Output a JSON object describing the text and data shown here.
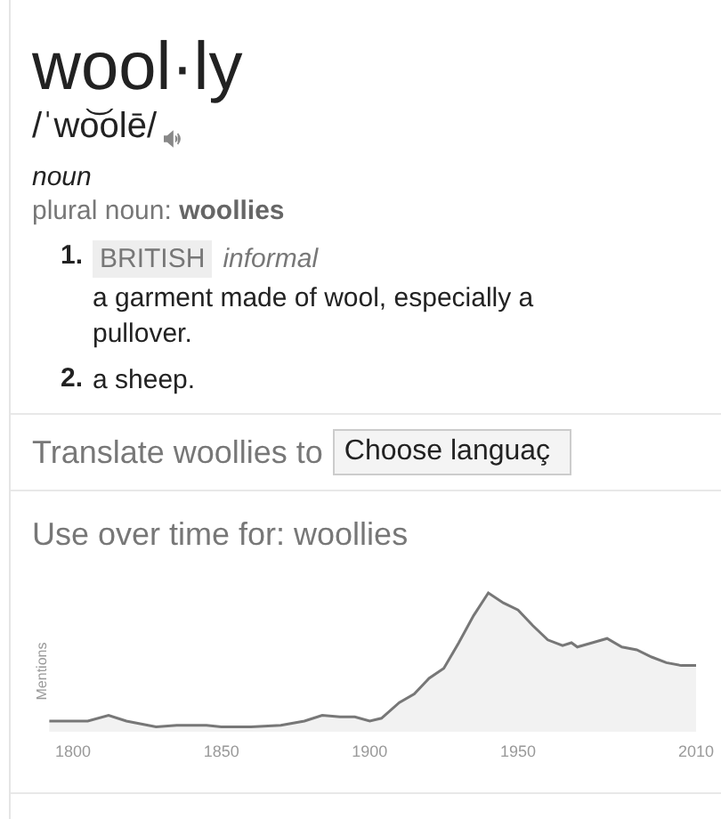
{
  "headword": "wool·ly",
  "pronunciation": "/ˈwo͝olē/",
  "part_of_speech": "noun",
  "plural": {
    "label": "plural noun:",
    "form": "woollies"
  },
  "senses": [
    {
      "number": "1.",
      "register": "BRITISH",
      "usage": "informal",
      "definition": "a garment made of wool, especially a pullover."
    },
    {
      "number": "2.",
      "definition": "a sheep."
    }
  ],
  "translate": {
    "label": "Translate woollies to",
    "placeholder": "Choose languaç"
  },
  "usage_chart": {
    "title": "Use over time for: woollies",
    "ylabel": "Mentions",
    "xticks": [
      "1800",
      "1850",
      "1900",
      "1950",
      "2010"
    ]
  }
}
